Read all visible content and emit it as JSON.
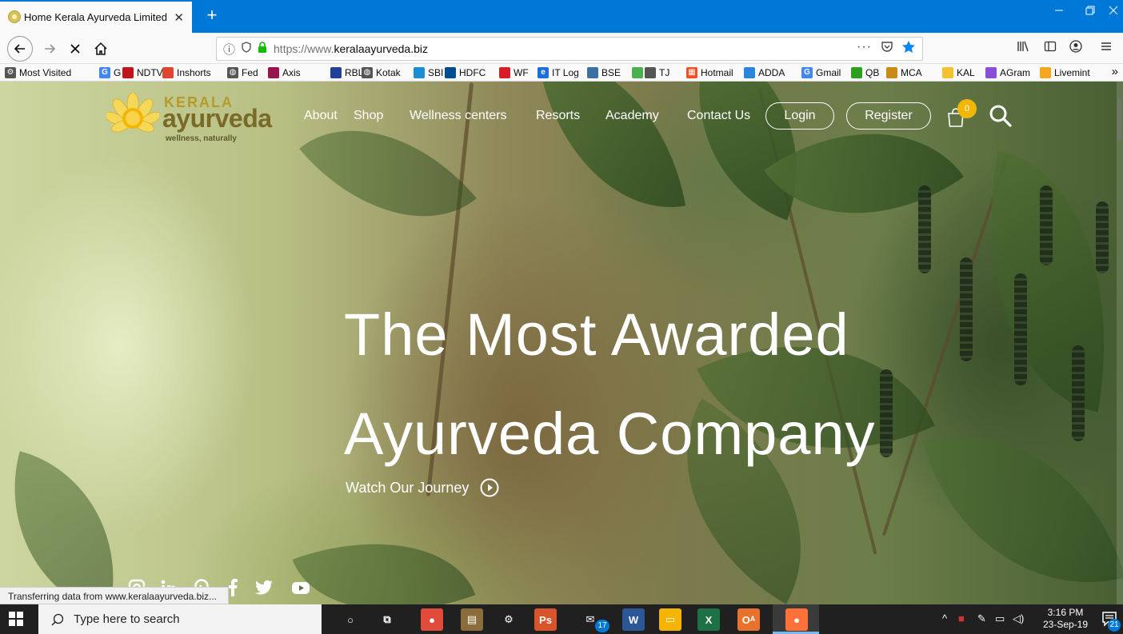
{
  "browser": {
    "tab_title": "Home Kerala Ayurveda Limited",
    "tab_close": "✕",
    "new_tab": "+",
    "url_prefix": "https://www.",
    "url_domain": "keralaayurveda.biz",
    "url_more": "···",
    "status_text": "Transferring data from www.keralaayurveda.biz..."
  },
  "bookmarks": [
    {
      "label": "Most Visited",
      "icon": "gear-icon",
      "color": "#555555"
    },
    {
      "label": "G",
      "icon": "google-icon",
      "color": "#4285f4"
    },
    {
      "label": "NDTV",
      "icon": "ndtv-icon",
      "color": "#c0161b"
    },
    {
      "label": "Inshorts",
      "icon": "inshorts-icon",
      "color": "#e0452f"
    },
    {
      "label": "Fed",
      "icon": "globe-icon",
      "color": "#555555"
    },
    {
      "label": "Axis",
      "icon": "axis-icon",
      "color": "#97144d"
    },
    {
      "label": "RBL",
      "icon": "rbl-icon",
      "color": "#21409a"
    },
    {
      "label": "Kotak",
      "icon": "globe-icon",
      "color": "#555555"
    },
    {
      "label": "SBI",
      "icon": "sbi-icon",
      "color": "#1a8ed1"
    },
    {
      "label": "HDFC",
      "icon": "hdfc-icon",
      "color": "#004c8f"
    },
    {
      "label": "WF",
      "icon": "wf-icon",
      "color": "#d71e28"
    },
    {
      "label": "IT Log",
      "icon": "ie-icon",
      "color": "#1e6fd9"
    },
    {
      "label": "BSE",
      "icon": "bse-icon",
      "color": "#3a6ea5"
    },
    {
      "label": "",
      "icon": "bookmark-icon",
      "color": "#4caf50"
    },
    {
      "label": "TJ",
      "icon": "tj-icon",
      "color": "#555555"
    },
    {
      "label": "Hotmail",
      "icon": "windows-icon",
      "color": "#f25022"
    },
    {
      "label": "ADDA",
      "icon": "adda-icon",
      "color": "#2b86d9"
    },
    {
      "label": "Gmail",
      "icon": "google-icon",
      "color": "#4285f4"
    },
    {
      "label": "QB",
      "icon": "qb-icon",
      "color": "#2ca01c"
    },
    {
      "label": "MCA",
      "icon": "emblem-icon",
      "color": "#c98a18"
    },
    {
      "label": "KAL",
      "icon": "kal-icon",
      "color": "#f2c230"
    },
    {
      "label": "AGram",
      "icon": "agram-icon",
      "color": "#8a4fd6"
    },
    {
      "label": "Livemint",
      "icon": "livemint-icon",
      "color": "#f5a623"
    }
  ],
  "site": {
    "logo": {
      "kerala": "KERALA",
      "ayurveda": "ayurveda",
      "tagline": "wellness, naturally"
    },
    "nav": [
      "About",
      "Shop",
      "Wellness centers",
      "Resorts",
      "Academy",
      "Contact Us"
    ],
    "login": "Login",
    "register": "Register",
    "cart_count": "0",
    "hero_line1": "The Most Awarded",
    "hero_line2": "Ayurveda Company",
    "watch_label": "Watch Our Journey",
    "social_icons": [
      "instagram-icon",
      "linkedin-icon",
      "pinterest-icon",
      "facebook-icon",
      "twitter-icon",
      "youtube-icon"
    ]
  },
  "taskbar": {
    "search_placeholder": "Type here to search",
    "apps": [
      {
        "name": "cortana-icon",
        "glyph": "○",
        "color": "#202020"
      },
      {
        "name": "task-view-icon",
        "glyph": "⧉",
        "color": "#202020"
      },
      {
        "name": "chrome-icon",
        "glyph": "●",
        "color": "#e04b3a"
      },
      {
        "name": "notebook-icon",
        "glyph": "▤",
        "color": "#8a6d3b"
      },
      {
        "name": "settings-icon",
        "glyph": "⚙",
        "color": "#202020"
      },
      {
        "name": "photoshop-icon",
        "glyph": "Ps",
        "color": "#d9542b"
      },
      {
        "name": "mail-icon",
        "glyph": "✉",
        "color": "#202020"
      },
      {
        "name": "word-icon",
        "glyph": "W",
        "color": "#2b5797"
      },
      {
        "name": "file-explorer-icon",
        "glyph": "▭",
        "color": "#f4b400"
      },
      {
        "name": "excel-icon",
        "glyph": "X",
        "color": "#1e7145"
      },
      {
        "name": "onenote-icon",
        "glyph": "Oᴬ",
        "color": "#e8712b"
      },
      {
        "name": "firefox-icon",
        "glyph": "●",
        "color": "#ff7139"
      }
    ],
    "mail_badge": "17",
    "time": "3:16 PM",
    "date": "23-Sep-19",
    "notification_count": "21"
  }
}
